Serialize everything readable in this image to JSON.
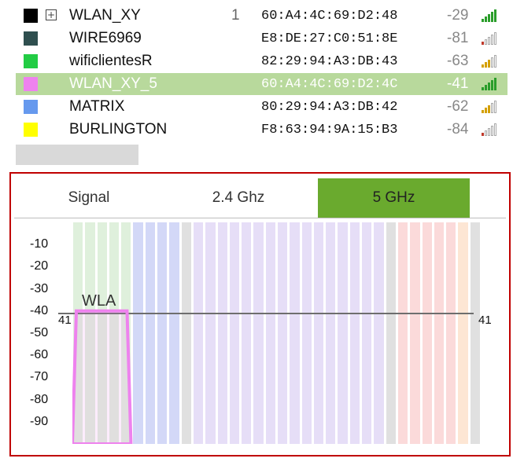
{
  "networks": [
    {
      "ssid": "WLAN_XY",
      "channel": "1",
      "mac": "60:A4:4C:69:D2:48",
      "rssi": "-29",
      "swatch": "#000000",
      "bars": 5,
      "bar_color": "#2a9d2a",
      "expandable": true,
      "selected": false
    },
    {
      "ssid": "WIRE6969",
      "channel": "",
      "mac": "E8:DE:27:C0:51:8E",
      "rssi": "-81",
      "swatch": "#2f4f4f",
      "bars": 1,
      "bar_color": "#c0392b",
      "expandable": false,
      "selected": false
    },
    {
      "ssid": "wificlientesR",
      "channel": "",
      "mac": "82:29:94:A3:DB:43",
      "rssi": "-63",
      "swatch": "#22cc44",
      "bars": 3,
      "bar_color": "#d4a000",
      "expandable": false,
      "selected": false
    },
    {
      "ssid": "WLAN_XY_5",
      "channel": "",
      "mac": "60:A4:4C:69:D2:4C",
      "rssi": "-41",
      "swatch": "#ee82ee",
      "bars": 5,
      "bar_color": "#2a9d2a",
      "expandable": false,
      "selected": true
    },
    {
      "ssid": "MATRIX",
      "channel": "",
      "mac": "80:29:94:A3:DB:42",
      "rssi": "-62",
      "swatch": "#6699ee",
      "bars": 3,
      "bar_color": "#d4a000",
      "expandable": false,
      "selected": false
    },
    {
      "ssid": "BURLINGTON",
      "channel": "",
      "mac": "F8:63:94:9A:15:B3",
      "rssi": "-84",
      "swatch": "#ffff00",
      "bars": 1,
      "bar_color": "#c0392b",
      "expandable": false,
      "selected": false
    }
  ],
  "expand_glyph": "+",
  "tabs": [
    {
      "label": "Signal",
      "active": false
    },
    {
      "label": "2.4 Ghz",
      "active": false
    },
    {
      "label": "5 GHz",
      "active": true
    }
  ],
  "chart_data": {
    "type": "area",
    "ylim": [
      -100,
      0
    ],
    "y_ticks": [
      "-10",
      "-20",
      "-30",
      "-40",
      "-50",
      "-60",
      "-70",
      "-80",
      "-90"
    ],
    "y_tick_values": [
      -10,
      -20,
      -30,
      -40,
      -50,
      -60,
      -70,
      -80,
      -90
    ],
    "threshold": {
      "value": -41,
      "left_label": "41",
      "right_label": "41"
    },
    "series": [
      {
        "name": "WLA",
        "level": -40,
        "start_col": 0,
        "end_col": 4,
        "color": "#ee82ee"
      }
    ],
    "channel_columns": [
      "#dff0dc",
      "#dff0dc",
      "#dff0dc",
      "#dff0dc",
      "#dff0dc",
      "#d3d8f7",
      "#d3d8f7",
      "#d3d8f7",
      "#d3d8f7",
      "#e0e0e0",
      "#e6def7",
      "#e6def7",
      "#e6def7",
      "#e6def7",
      "#e6def7",
      "#e6def7",
      "#e6def7",
      "#e6def7",
      "#e6def7",
      "#e6def7",
      "#e6def7",
      "#e6def7",
      "#e6def7",
      "#e6def7",
      "#e6def7",
      "#e6def7",
      "#e0e0e0",
      "#fbdada",
      "#fbdada",
      "#fbdada",
      "#fbdada",
      "#fbdada",
      "#fde6d4",
      "#e0e0e0"
    ]
  }
}
